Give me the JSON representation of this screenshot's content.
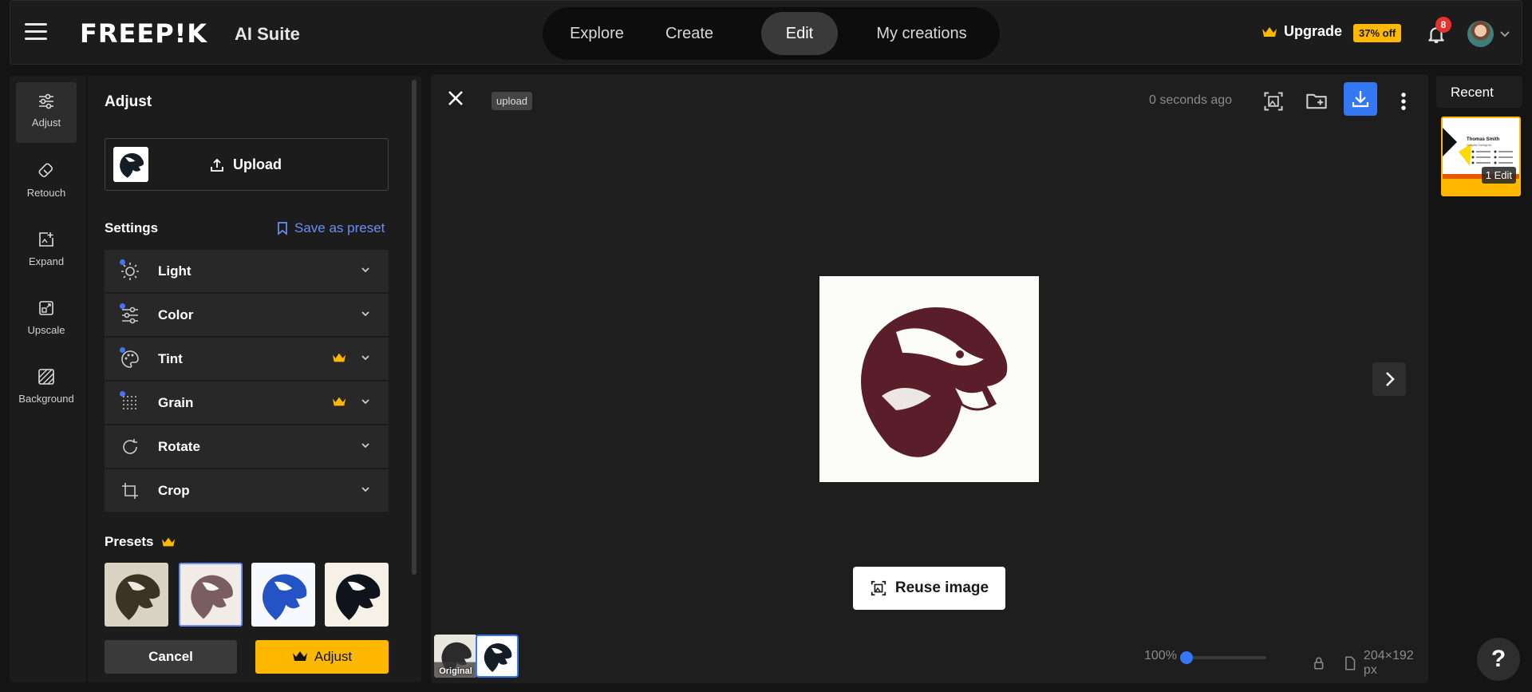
{
  "header": {
    "logo": "FREEP!K",
    "suite": "AI Suite",
    "nav": [
      {
        "label": "Explore"
      },
      {
        "label": "Create"
      },
      {
        "label": "Edit",
        "active": true
      },
      {
        "label": "My creations"
      }
    ],
    "upgrade_label": "Upgrade",
    "discount": "37% off",
    "notifications": "8"
  },
  "tools": [
    {
      "label": "Adjust",
      "icon": "sliders-icon",
      "active": true
    },
    {
      "label": "Retouch",
      "icon": "eraser-icon"
    },
    {
      "label": "Expand",
      "icon": "expand-icon"
    },
    {
      "label": "Upscale",
      "icon": "upscale-icon"
    },
    {
      "label": "Background",
      "icon": "background-icon"
    }
  ],
  "panel": {
    "title": "Adjust",
    "upload_label": "Upload",
    "settings_label": "Settings",
    "save_preset": "Save as preset",
    "settings": [
      {
        "label": "Light",
        "icon": "sun-icon",
        "dot": true,
        "premium": false
      },
      {
        "label": "Color",
        "icon": "sliders-icon",
        "dot": true,
        "premium": false
      },
      {
        "label": "Tint",
        "icon": "palette-icon",
        "dot": true,
        "premium": true
      },
      {
        "label": "Grain",
        "icon": "grain-icon",
        "dot": true,
        "premium": true
      },
      {
        "label": "Rotate",
        "icon": "rotate-icon",
        "dot": false,
        "premium": false
      },
      {
        "label": "Crop",
        "icon": "crop-icon",
        "dot": false,
        "premium": false
      }
    ],
    "presets_label": "Presets",
    "cancel": "Cancel",
    "adjust": "Adjust"
  },
  "canvas": {
    "tag": "upload",
    "timestamp": "0 seconds ago",
    "reuse_label": "Reuse image",
    "original_label": "Original",
    "zoom": "100%",
    "zoom_level": 0.0,
    "dimensions": "204×192 px"
  },
  "recent": {
    "title": "Recent",
    "edit_badge": "1 Edit",
    "card_name": "Thomas Smith",
    "card_role": "Graphic Designer"
  },
  "colors": {
    "accent": "#ffb800",
    "blue": "#3478f6",
    "link": "#6b8ff7",
    "mascot": "#5a1e2a"
  }
}
